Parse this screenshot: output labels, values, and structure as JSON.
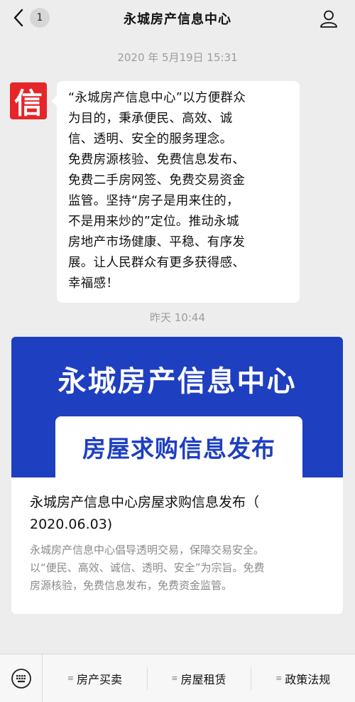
{
  "header": {
    "back_badge": "1",
    "title": "永城房产信息中心"
  },
  "messages": [
    {
      "timestamp": "2020 年 5月19日 15:31",
      "avatar_char": "信",
      "text_lines": [
        "“永城房产信息中心”以方便群众",
        "为目的，秉承便民、高效、诚",
        "信、透明、安全的服务理念。",
        "免费房源核验、免费信息发布、",
        "免费二手房网签、免费交易资金",
        "监管。坚持“房子是用来住的，",
        "不是用来炒的”定位。推动永城",
        "房地产市场健康、平稳、有序发",
        "展。让人民群众有更多获得感、",
        "幸福感！"
      ]
    }
  ],
  "article": {
    "timestamp": "昨天 10:44",
    "cover_title": "永城房产信息中心",
    "cover_subtitle": "房屋求购信息发布",
    "title_lines": [
      "永城房产信息中心房屋求购信息发布（",
      "2020.06.03)"
    ],
    "desc_lines": [
      "永城房产信息中心倡导透明交易，保障交易安全。",
      "以“便民、高效、诚信、透明、安全”为宗旨。免费",
      "房源核验，免费信息发布，免费资金监管。"
    ]
  },
  "menu": {
    "items": [
      {
        "label": "房产买卖"
      },
      {
        "label": "房屋租赁"
      },
      {
        "label": "政策法规"
      }
    ]
  },
  "colors": {
    "brand_red": "#e52528",
    "cover_blue": "#1e3fbf"
  }
}
